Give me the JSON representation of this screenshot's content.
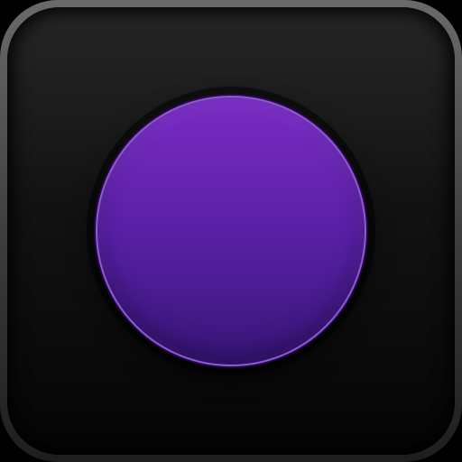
{
  "app_icon": {
    "kind": "rounded-square icon with circular button",
    "colors": {
      "frame_light": "#6a6a6a",
      "frame_dark": "#1e1e1e",
      "face_top": "#262626",
      "face_bottom": "#050505",
      "orb_top": "#7b2bc4",
      "orb_bottom": "#371677",
      "orb_rim": "#8f59d6"
    },
    "icons": [
      "purple-circle-button-icon"
    ]
  }
}
